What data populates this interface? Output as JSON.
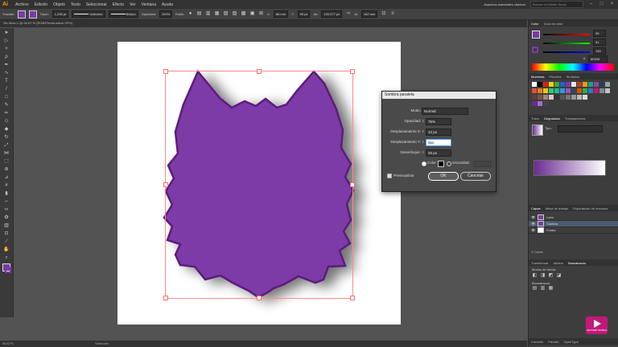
{
  "app": {
    "logo": "Ai",
    "menu": [
      "Archivo",
      "Edición",
      "Objeto",
      "Texto",
      "Seleccionar",
      "Efecto",
      "Ver",
      "Ventana",
      "Ayuda"
    ],
    "workspace": "Aspectos esenciales clásicos",
    "search_placeholder": "Buscar en Adobe Stock"
  },
  "control_bar": {
    "selection": "Trazado",
    "stroke_label": "Trazo:",
    "stroke_value": "1,236 pt",
    "profile_uniform": "Uniforme",
    "brush_basic": "Básico",
    "opacity_label": "Opacidad:",
    "opacity_value": "100%",
    "style_label": "Estilo:",
    "x_value": "86 mm",
    "y_value": "95 px",
    "w_value": "100,977 px",
    "h_value": "182 mm",
    "fill_color": "#7b3aa6"
  },
  "document": {
    "tab_title": "Sin título-1 @ 66,67 % (RGB/Previsualizar GPU)",
    "zoom": "66,67%",
    "status": "Selección"
  },
  "tools": [
    "selection",
    "direct-select",
    "magic-wand",
    "lasso",
    "pen",
    "curvature",
    "type",
    "line",
    "rectangle",
    "paintbrush",
    "pencil",
    "shaper",
    "eraser",
    "rotate",
    "scale",
    "width",
    "free-transform",
    "shape-builder",
    "perspective",
    "mesh",
    "gradient",
    "eyedropper",
    "blend",
    "symbol-sprayer",
    "graph",
    "artboard",
    "slice",
    "hand",
    "zoom"
  ],
  "dialog": {
    "title": "Sombra paralela",
    "mode_label": "Modo:",
    "mode_value": "Normal",
    "opacity_label": "Opacidad:",
    "opacity_value": "75%",
    "x_offset_label": "Desplazamiento X:",
    "x_offset_value": "12 px",
    "y_offset_label": "Desplazamiento Y:",
    "y_offset_value": "5px",
    "blur_label": "Desenfoque:",
    "blur_value": "25 px",
    "color_label": "Color:",
    "darkness_label": "Oscuridad:",
    "preview_label": "Previsualizar",
    "ok_label": "OK",
    "cancel_label": "Cancelar",
    "shadow_color": "#000000"
  },
  "panels": {
    "color_tabs": [
      "Color",
      "Guía de color"
    ],
    "color_values": {
      "r": "95",
      "g": "51",
      "b": "155",
      "hex": "6f339f"
    },
    "swatches_tabs": [
      "Muestras",
      "Pinceles",
      "Símbolos"
    ],
    "gradient_tabs": [
      "Trazo",
      "Degradado",
      "Transparencia"
    ],
    "gradient_type_label": "Tipo:",
    "layers_tabs": [
      "Capas",
      "Mesa de trabajo",
      "Exportación de recursos"
    ],
    "layers": [
      {
        "name": "Lobo",
        "selected": false
      },
      {
        "name": "Sombra",
        "selected": true
      },
      {
        "name": "Fondo",
        "selected": false
      }
    ],
    "layers_count": "3 Capas",
    "bottom_tabs": [
      "Transformar",
      "Alinear",
      "Buscatrazos"
    ],
    "pathfinder_shape_label": "Modos de forma:",
    "pathfinder_label": "Buscatrazos:",
    "bottom2_tabs": [
      "Carácter",
      "Párrafo",
      "OpenType"
    ],
    "badge": "SEOWEB MOBILE"
  },
  "colors": {
    "wolf_fill": "#7b3aa6",
    "wolf_stroke": "#5b1a7c",
    "selection": "#ff6f6f",
    "panel_bg": "#3d3d3d",
    "app_bg": "#535353"
  }
}
